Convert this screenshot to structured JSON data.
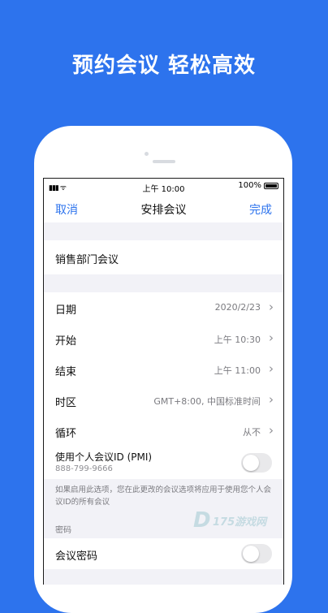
{
  "headline": "预约会议 轻松高效",
  "status_bar": {
    "time": "上午 10:00",
    "battery": "100%"
  },
  "nav": {
    "cancel": "取消",
    "title": "安排会议",
    "done": "完成"
  },
  "topic": "销售部门会议",
  "rows": [
    {
      "label": "日期",
      "value": "2020/2/23"
    },
    {
      "label": "开始",
      "value": "上午 10:30"
    },
    {
      "label": "结束",
      "value": "上午 11:00"
    },
    {
      "label": "时区",
      "value": "GMT+8:00, 中国标准时间"
    },
    {
      "label": "循环",
      "value": "从不"
    }
  ],
  "pmi": {
    "label": "使用个人会议ID (PMI)",
    "id": "888-799-9666",
    "enabled": false
  },
  "pmi_note": "如果启用此选项，您在此更改的会议选项将应用于使用您个人会议ID的所有会议",
  "password_section": "密码",
  "password_row": {
    "label": "会议密码",
    "enabled": false
  },
  "watermark": {
    "logo": "D",
    "text": "175游戏网"
  },
  "colors": {
    "brand_blue": "#2d73ed",
    "screen_bg": "#f2f2f7"
  }
}
